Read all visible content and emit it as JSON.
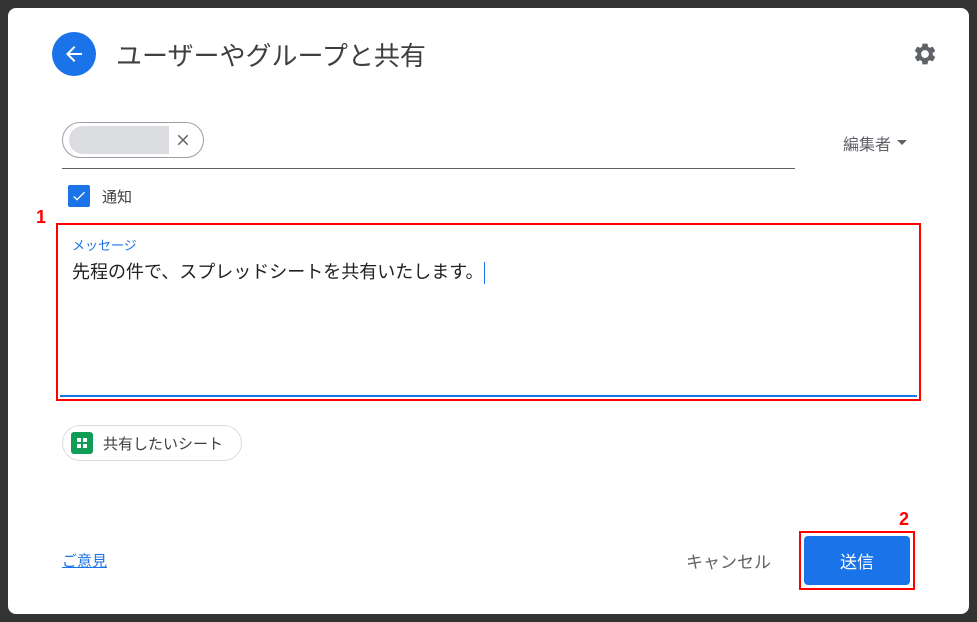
{
  "header": {
    "title": "ユーザーやグループと共有"
  },
  "permission": {
    "label": "編集者"
  },
  "notify": {
    "label": "通知"
  },
  "message": {
    "label": "メッセージ",
    "text": "先程の件で、スプレッドシートを共有いたします。"
  },
  "attachment": {
    "name": "共有したいシート"
  },
  "footer": {
    "feedback": "ご意見",
    "cancel": "キャンセル",
    "send": "送信"
  },
  "annotations": {
    "one": "1",
    "two": "2"
  }
}
